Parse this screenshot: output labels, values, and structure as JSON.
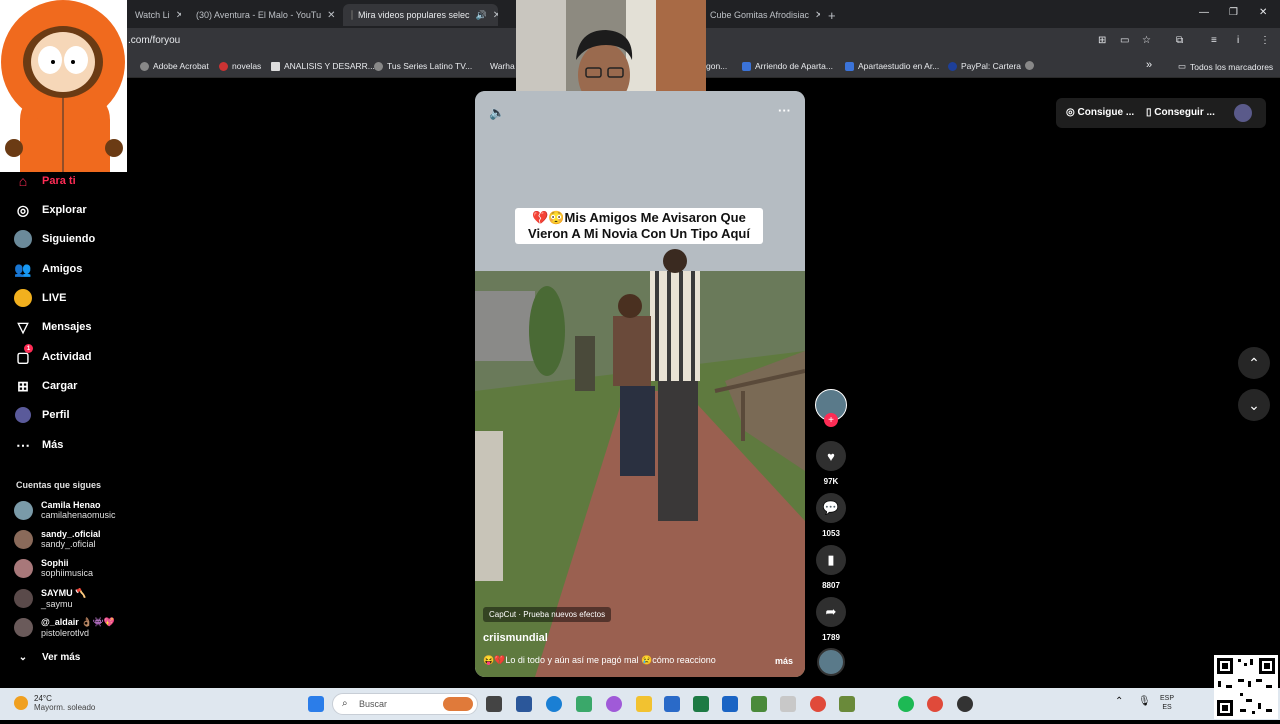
{
  "browser": {
    "tabs": [
      {
        "label": "Watch Li",
        "active": false
      },
      {
        "label": "(30) Aventura - El Malo - YouTu",
        "active": false
      },
      {
        "label": "Mira videos populares selec",
        "active": true
      },
      {
        "label": "Cube Gomitas Afrodisiac",
        "active": false
      }
    ],
    "new_tab": "+",
    "url": ".com/foryou",
    "bookmarks": [
      "Adobe Acrobat",
      "novelas",
      "ANALISIS Y DESARR...",
      "Tus Series Latino TV...",
      "Warha",
      "gon...",
      "Arriendo de Aparta...",
      "Apartaestudio en Ar...",
      "PayPal: Cartera"
    ],
    "bookmarks_overflow": "»",
    "all_bookmarks": "Todos los marcadores"
  },
  "sidebar": {
    "nav": [
      {
        "label": "Para ti",
        "icon": "home-icon",
        "active": true
      },
      {
        "label": "Explorar",
        "icon": "compass-icon"
      },
      {
        "label": "Siguiendo",
        "icon": "following-avatar-icon"
      },
      {
        "label": "Amigos",
        "icon": "friends-icon"
      },
      {
        "label": "LIVE",
        "icon": "live-icon"
      },
      {
        "label": "Mensajes",
        "icon": "messages-icon"
      },
      {
        "label": "Actividad",
        "icon": "activity-icon",
        "badge": "1"
      },
      {
        "label": "Cargar",
        "icon": "upload-icon"
      },
      {
        "label": "Perfil",
        "icon": "profile-icon"
      },
      {
        "label": "Más",
        "icon": "more-icon"
      }
    ],
    "following_title": "Cuentas que sigues",
    "accounts": [
      {
        "name": "Camila Henao",
        "handle": "camilahenaomusic"
      },
      {
        "name": "sandy_.oficial",
        "handle": "sandy_.oficial"
      },
      {
        "name": "Sophii",
        "handle": "sophiimusica"
      },
      {
        "name": "SAYMU 🪓",
        "handle": "_saymu"
      },
      {
        "name": "@_aldair 👌🏽👾💖",
        "handle": "pistolerotlvd"
      }
    ],
    "see_more": "Ver más"
  },
  "video": {
    "caption": "💔😳Mis Amigos Me Avisaron Que Vieron A Mi Novia Con Un Tipo Aquí",
    "capcut_label": "CapCut · Prueba nuevos efectos",
    "author": "criismundial",
    "description": "😝💔Lo di todo y aún así me pagó mal 😢cómo reacciono",
    "more": "más"
  },
  "actions": {
    "likes": "97K",
    "comments": "1053",
    "saves": "8807",
    "shares": "1789"
  },
  "top_buttons": {
    "get_coins": "Consigue ...",
    "get_app": "Conseguir ..."
  },
  "taskbar": {
    "temp": "24°C",
    "weather": "Mayorm. soleado",
    "search_placeholder": "Buscar",
    "lang1": "ESP",
    "lang2": "ES"
  },
  "colors": {
    "accent": "#fe2c55",
    "background": "#000000",
    "taskbar": "#dfe7ef"
  }
}
